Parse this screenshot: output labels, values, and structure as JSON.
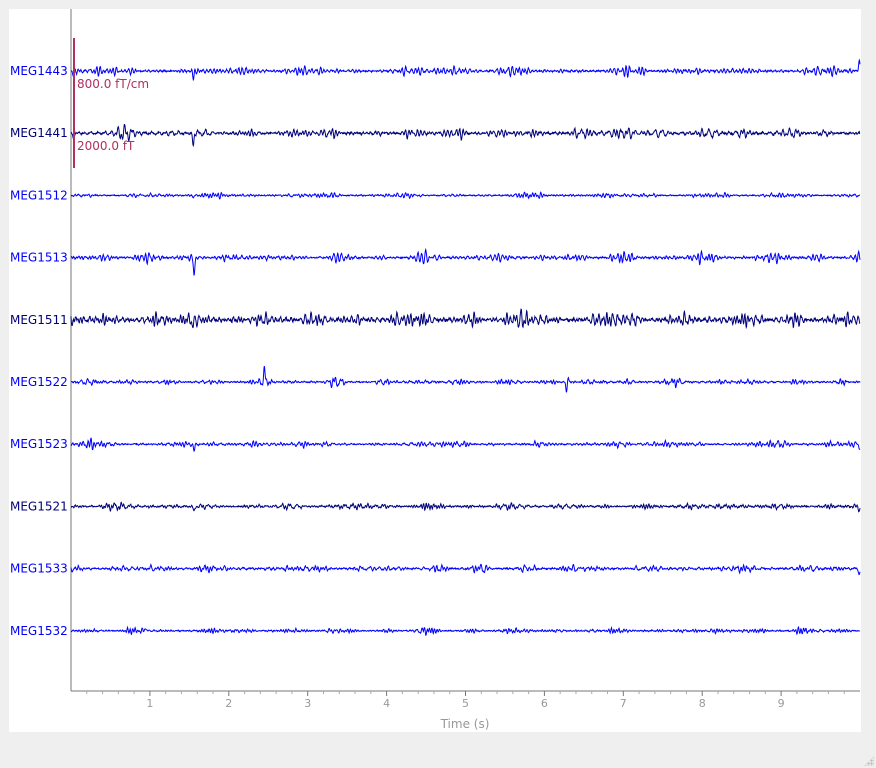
{
  "chart_data": {
    "type": "line",
    "title": "",
    "xlabel": "Time (s)",
    "ylabel": "",
    "xlim": [
      0,
      10
    ],
    "x_ticks": [
      1,
      2,
      3,
      4,
      5,
      6,
      7,
      8,
      9
    ],
    "x_tick_labels": [
      "1",
      "2",
      "3",
      "4",
      "5",
      "6",
      "7",
      "8",
      "9"
    ],
    "grid": false,
    "legend": "none",
    "channels": [
      {
        "name": "MEG1443",
        "type": "grad",
        "color": "#0000ff",
        "amp": 0.42,
        "spikes": [
          [
            1.55,
            0.55
          ],
          [
            0.03,
            0.3
          ],
          [
            9.99,
            -0.8
          ]
        ]
      },
      {
        "name": "MEG1441",
        "type": "grad",
        "color": "#00007a",
        "amp": 0.5,
        "spikes": [
          [
            1.55,
            0.8
          ],
          [
            0.03,
            0.3
          ]
        ]
      },
      {
        "name": "MEG1512",
        "type": "grad",
        "color": "#0000ff",
        "amp": 0.26,
        "spikes": [
          [
            1.55,
            0.25
          ]
        ]
      },
      {
        "name": "MEG1513",
        "type": "grad",
        "color": "#0000ff",
        "amp": 0.38,
        "spikes": [
          [
            1.56,
            1.45
          ]
        ]
      },
      {
        "name": "MEG1511",
        "type": "grad",
        "color": "#00007a",
        "amp": 0.72,
        "spikes": [
          [
            1.55,
            0.4
          ]
        ]
      },
      {
        "name": "MEG1522",
        "type": "grad",
        "color": "#0000ff",
        "amp": 0.28,
        "spikes": [
          [
            2.45,
            -1.6
          ],
          [
            2.42,
            0.2
          ],
          [
            6.28,
            1.15
          ],
          [
            6.3,
            -0.55
          ]
        ]
      },
      {
        "name": "MEG1523",
        "type": "grad",
        "color": "#0000ff",
        "amp": 0.3,
        "spikes": [
          [
            1.56,
            0.75
          ],
          [
            9.99,
            0.45
          ]
        ]
      },
      {
        "name": "MEG1521",
        "type": "grad",
        "color": "#00007a",
        "amp": 0.34,
        "spikes": [
          [
            1.56,
            0.55
          ],
          [
            9.99,
            0.35
          ]
        ]
      },
      {
        "name": "MEG1533",
        "type": "grad",
        "color": "#0000ff",
        "amp": 0.36,
        "spikes": [
          [
            9.99,
            0.6
          ]
        ]
      },
      {
        "name": "MEG1532",
        "type": "grad",
        "color": "#0000ff",
        "amp": 0.28,
        "spikes": [
          [
            0.95,
            -0.35
          ]
        ]
      }
    ],
    "scale_bars": [
      {
        "label": "800.0 fT/cm",
        "color": "#b03060"
      },
      {
        "label": "2000.0 fT",
        "color": "#b03060"
      }
    ]
  }
}
